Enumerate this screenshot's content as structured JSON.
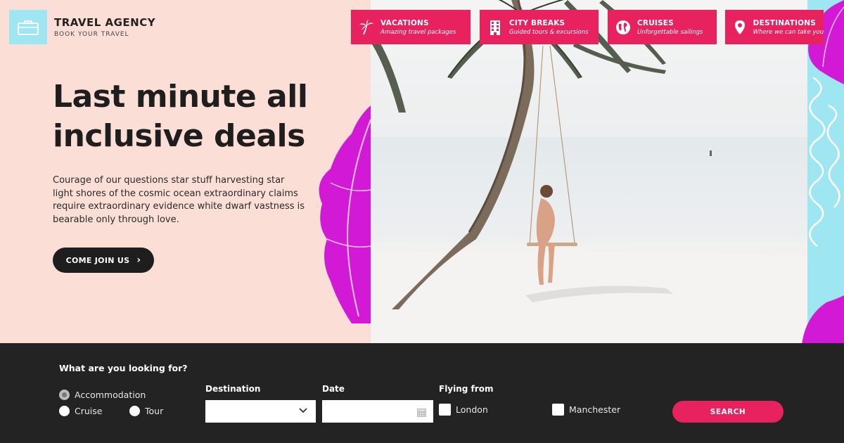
{
  "brand": {
    "title": "TRAVEL AGENCY",
    "subtitle": "BOOK YOUR TRAVEL",
    "icon": "briefcase-icon"
  },
  "nav": [
    {
      "title": "VACATIONS",
      "subtitle": "Amazing travel packages",
      "icon": "palm-tree-icon"
    },
    {
      "title": "CITY BREAKS",
      "subtitle": "Guided tours & excursions",
      "icon": "building-icon"
    },
    {
      "title": "CRUISES",
      "subtitle": "Unforgettable sailings",
      "icon": "globe-icon"
    },
    {
      "title": "DESTINATIONS",
      "subtitle": "Where we can take you",
      "icon": "map-pin-icon"
    }
  ],
  "hero": {
    "headline_line1": "Last minute all",
    "headline_line2": "inclusive deals",
    "description": "Courage of our questions star stuff harvesting star light shores of the cosmic ocean extraordinary claims require extraordinary evidence white dwarf vastness is bearable only through love.",
    "cta_label": "COME JOIN US"
  },
  "search": {
    "title": "What are you looking for?",
    "types": [
      {
        "label": "Accommodation",
        "checked": true
      },
      {
        "label": "Cruise",
        "checked": false
      },
      {
        "label": "Tour",
        "checked": false
      }
    ],
    "destination_label": "Destination",
    "destination_value": "",
    "date_label": "Date",
    "date_value": "",
    "flying_label": "Flying from",
    "flying_options": [
      {
        "label": "London",
        "checked": false
      },
      {
        "label": "Manchester",
        "checked": false
      }
    ],
    "button_label": "SEARCH"
  },
  "colors": {
    "accent": "#e8215f",
    "peach": "#fbded5",
    "aqua": "#9fe6f3",
    "dark": "#232323",
    "magenta": "#d21ad6"
  }
}
